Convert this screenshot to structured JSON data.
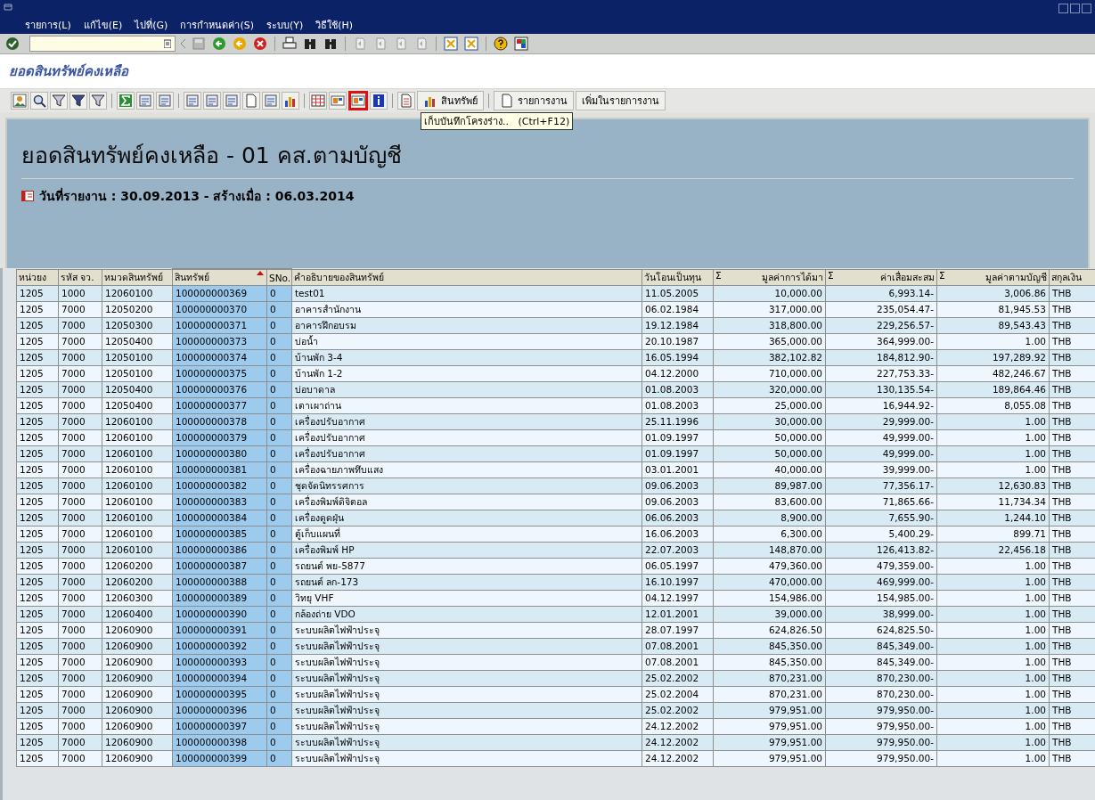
{
  "menu_bar": [
    {
      "label": "รายการ(L)"
    },
    {
      "label": "แก้ไข(E)"
    },
    {
      "label": "ไปที่(G)"
    },
    {
      "label": "การกำหนดค่า(S)"
    },
    {
      "label": "ระบบ(Y)"
    },
    {
      "label": "วิธีใช้(H)"
    }
  ],
  "screen_title": "ยอดสินทรัพย์คงเหลือ",
  "app_toolbar": [
    {
      "kind": "icon",
      "highlighted": false
    },
    {
      "kind": "icon",
      "highlighted": false
    },
    {
      "kind": "icon",
      "highlighted": false
    },
    {
      "kind": "icon",
      "highlighted": false
    },
    {
      "kind": "icon",
      "highlighted": false
    },
    {
      "kind": "separator"
    },
    {
      "kind": "icon",
      "highlighted": false
    },
    {
      "kind": "icon",
      "highlighted": false
    },
    {
      "kind": "icon",
      "highlighted": false
    },
    {
      "kind": "separator"
    },
    {
      "kind": "icon",
      "highlighted": false
    },
    {
      "kind": "icon",
      "highlighted": false
    },
    {
      "kind": "icon",
      "highlighted": false
    },
    {
      "kind": "icon",
      "highlighted": false
    },
    {
      "kind": "icon",
      "highlighted": false
    },
    {
      "kind": "icon",
      "highlighted": false
    },
    {
      "kind": "separator"
    },
    {
      "kind": "icon",
      "highlighted": false
    },
    {
      "kind": "icon",
      "highlighted": false
    },
    {
      "kind": "icon",
      "highlighted": true
    },
    {
      "kind": "icon",
      "highlighted": false
    },
    {
      "kind": "separator"
    },
    {
      "kind": "icon",
      "highlighted": false
    },
    {
      "kind": "icon_text",
      "label": "สินทรัพย์"
    },
    {
      "kind": "separator"
    },
    {
      "kind": "icon_text",
      "label": "รายการงาน"
    },
    {
      "kind": "text",
      "label": "เพิ่มในรายการงาน"
    }
  ],
  "tooltip": "เก็บบันทึกโครงร่าง..   (Ctrl+F12)",
  "report": {
    "title": "ยอดสินทรัพย์คงเหลือ - 01 คส.ตามบัญชี",
    "date_line": "วันที่รายงาน : 30.09.2013 - สร้างเมื่อ : 06.03.2014"
  },
  "table": {
    "columns": [
      {
        "label": "หน่วยง",
        "key": false,
        "sorted": false
      },
      {
        "label": "รหัส จว.",
        "key": false,
        "sorted": false
      },
      {
        "label": "หมวดสินทรัพย์",
        "key": false,
        "sorted": false
      },
      {
        "label": "สินทรัพย์",
        "key": true,
        "sorted": true
      },
      {
        "label": "SNo.",
        "key": true,
        "sorted": false
      },
      {
        "label": "คำอธิบายของสินทรัพย์",
        "key": false,
        "sorted": false
      },
      {
        "label": "วันโอนเป็นทุน",
        "key": false,
        "sorted": false
      },
      {
        "label": "มูลค่าการได้มา",
        "key": false,
        "sorted": false,
        "total_mark": "Σ"
      },
      {
        "label": "ค่าเสื่อมสะสม",
        "key": false,
        "sorted": false,
        "total_mark": "Σ"
      },
      {
        "label": "มูลค่าตามบัญชี",
        "key": false,
        "sorted": false,
        "total_mark": "Σ"
      },
      {
        "label": "สกุลเงิน",
        "key": false,
        "sorted": false
      }
    ],
    "rows": [
      [
        "1205",
        "1000",
        "12060100",
        "100000000369",
        "0",
        "test01",
        "11.05.2005",
        "10,000.00",
        "6,993.14-",
        "3,006.86",
        "THB"
      ],
      [
        "1205",
        "7000",
        "12050200",
        "100000000370",
        "0",
        "อาคารสำนักงาน",
        "06.02.1984",
        "317,000.00",
        "235,054.47-",
        "81,945.53",
        "THB"
      ],
      [
        "1205",
        "7000",
        "12050300",
        "100000000371",
        "0",
        "อาคารฝึกอบรม",
        "19.12.1984",
        "318,800.00",
        "229,256.57-",
        "89,543.43",
        "THB"
      ],
      [
        "1205",
        "7000",
        "12050400",
        "100000000373",
        "0",
        "บ่อน้ำ",
        "20.10.1987",
        "365,000.00",
        "364,999.00-",
        "1.00",
        "THB"
      ],
      [
        "1205",
        "7000",
        "12050100",
        "100000000374",
        "0",
        "บ้านพัก 3-4",
        "16.05.1994",
        "382,102.82",
        "184,812.90-",
        "197,289.92",
        "THB"
      ],
      [
        "1205",
        "7000",
        "12050100",
        "100000000375",
        "0",
        "บ้านพัก 1-2",
        "04.12.2000",
        "710,000.00",
        "227,753.33-",
        "482,246.67",
        "THB"
      ],
      [
        "1205",
        "7000",
        "12050400",
        "100000000376",
        "0",
        "บ่อบาดาล",
        "01.08.2003",
        "320,000.00",
        "130,135.54-",
        "189,864.46",
        "THB"
      ],
      [
        "1205",
        "7000",
        "12050400",
        "100000000377",
        "0",
        "เตาเผาถ่าน",
        "01.08.2003",
        "25,000.00",
        "16,944.92-",
        "8,055.08",
        "THB"
      ],
      [
        "1205",
        "7000",
        "12060100",
        "100000000378",
        "0",
        "เครื่องปรับอากาศ",
        "25.11.1996",
        "30,000.00",
        "29,999.00-",
        "1.00",
        "THB"
      ],
      [
        "1205",
        "7000",
        "12060100",
        "100000000379",
        "0",
        "เครื่องปรับอากาศ",
        "01.09.1997",
        "50,000.00",
        "49,999.00-",
        "1.00",
        "THB"
      ],
      [
        "1205",
        "7000",
        "12060100",
        "100000000380",
        "0",
        "เครื่องปรับอากาศ",
        "01.09.1997",
        "50,000.00",
        "49,999.00-",
        "1.00",
        "THB"
      ],
      [
        "1205",
        "7000",
        "12060100",
        "100000000381",
        "0",
        "เครื่องฉายภาพทึบแสง",
        "03.01.2001",
        "40,000.00",
        "39,999.00-",
        "1.00",
        "THB"
      ],
      [
        "1205",
        "7000",
        "12060100",
        "100000000382",
        "0",
        "ชุดจัดนิทรรศการ",
        "09.06.2003",
        "89,987.00",
        "77,356.17-",
        "12,630.83",
        "THB"
      ],
      [
        "1205",
        "7000",
        "12060100",
        "100000000383",
        "0",
        "เครื่องพิมพ์ดิจิตอล",
        "09.06.2003",
        "83,600.00",
        "71,865.66-",
        "11,734.34",
        "THB"
      ],
      [
        "1205",
        "7000",
        "12060100",
        "100000000384",
        "0",
        "เครื่องดูดฝุ่น",
        "06.06.2003",
        "8,900.00",
        "7,655.90-",
        "1,244.10",
        "THB"
      ],
      [
        "1205",
        "7000",
        "12060100",
        "100000000385",
        "0",
        "ตู้เก็บแผนที่",
        "16.06.2003",
        "6,300.00",
        "5,400.29-",
        "899.71",
        "THB"
      ],
      [
        "1205",
        "7000",
        "12060100",
        "100000000386",
        "0",
        "เครื่องพิมพ์ HP",
        "22.07.2003",
        "148,870.00",
        "126,413.82-",
        "22,456.18",
        "THB"
      ],
      [
        "1205",
        "7000",
        "12060200",
        "100000000387",
        "0",
        "รถยนต์  พย-5877",
        "06.05.1997",
        "479,360.00",
        "479,359.00-",
        "1.00",
        "THB"
      ],
      [
        "1205",
        "7000",
        "12060200",
        "100000000388",
        "0",
        "รถยนต์  ลก-173",
        "16.10.1997",
        "470,000.00",
        "469,999.00-",
        "1.00",
        "THB"
      ],
      [
        "1205",
        "7000",
        "12060300",
        "100000000389",
        "0",
        "วิทยุ  VHF",
        "04.12.1997",
        "154,986.00",
        "154,985.00-",
        "1.00",
        "THB"
      ],
      [
        "1205",
        "7000",
        "12060400",
        "100000000390",
        "0",
        "กล้องถ่าย VDO",
        "12.01.2001",
        "39,000.00",
        "38,999.00-",
        "1.00",
        "THB"
      ],
      [
        "1205",
        "7000",
        "12060900",
        "100000000391",
        "0",
        "ระบบผลิตไฟฟ้าประจุ",
        "28.07.1997",
        "624,826.50",
        "624,825.50-",
        "1.00",
        "THB"
      ],
      [
        "1205",
        "7000",
        "12060900",
        "100000000392",
        "0",
        "ระบบผลิตไฟฟ้าประจุ",
        "07.08.2001",
        "845,350.00",
        "845,349.00-",
        "1.00",
        "THB"
      ],
      [
        "1205",
        "7000",
        "12060900",
        "100000000393",
        "0",
        "ระบบผลิตไฟฟ้าประจุ",
        "07.08.2001",
        "845,350.00",
        "845,349.00-",
        "1.00",
        "THB"
      ],
      [
        "1205",
        "7000",
        "12060900",
        "100000000394",
        "0",
        "ระบบผลิตไฟฟ้าประจุ",
        "25.02.2002",
        "870,231.00",
        "870,230.00-",
        "1.00",
        "THB"
      ],
      [
        "1205",
        "7000",
        "12060900",
        "100000000395",
        "0",
        "ระบบผลิตไฟฟ้าประจุ",
        "25.02.2004",
        "870,231.00",
        "870,230.00-",
        "1.00",
        "THB"
      ],
      [
        "1205",
        "7000",
        "12060900",
        "100000000396",
        "0",
        "ระบบผลิตไฟฟ้าประจุ",
        "25.02.2002",
        "979,951.00",
        "979,950.00-",
        "1.00",
        "THB"
      ],
      [
        "1205",
        "7000",
        "12060900",
        "100000000397",
        "0",
        "ระบบผลิตไฟฟ้าประจุ",
        "24.12.2002",
        "979,951.00",
        "979,950.00-",
        "1.00",
        "THB"
      ],
      [
        "1205",
        "7000",
        "12060900",
        "100000000398",
        "0",
        "ระบบผลิตไฟฟ้าประจุ",
        "24.12.2002",
        "979,951.00",
        "979,950.00-",
        "1.00",
        "THB"
      ],
      [
        "1205",
        "7000",
        "12060900",
        "100000000399",
        "0",
        "ระบบผลิตไฟฟ้าประจุ",
        "24.12.2002",
        "979,951.00",
        "979,950.00-",
        "1.00",
        "THB"
      ]
    ]
  }
}
